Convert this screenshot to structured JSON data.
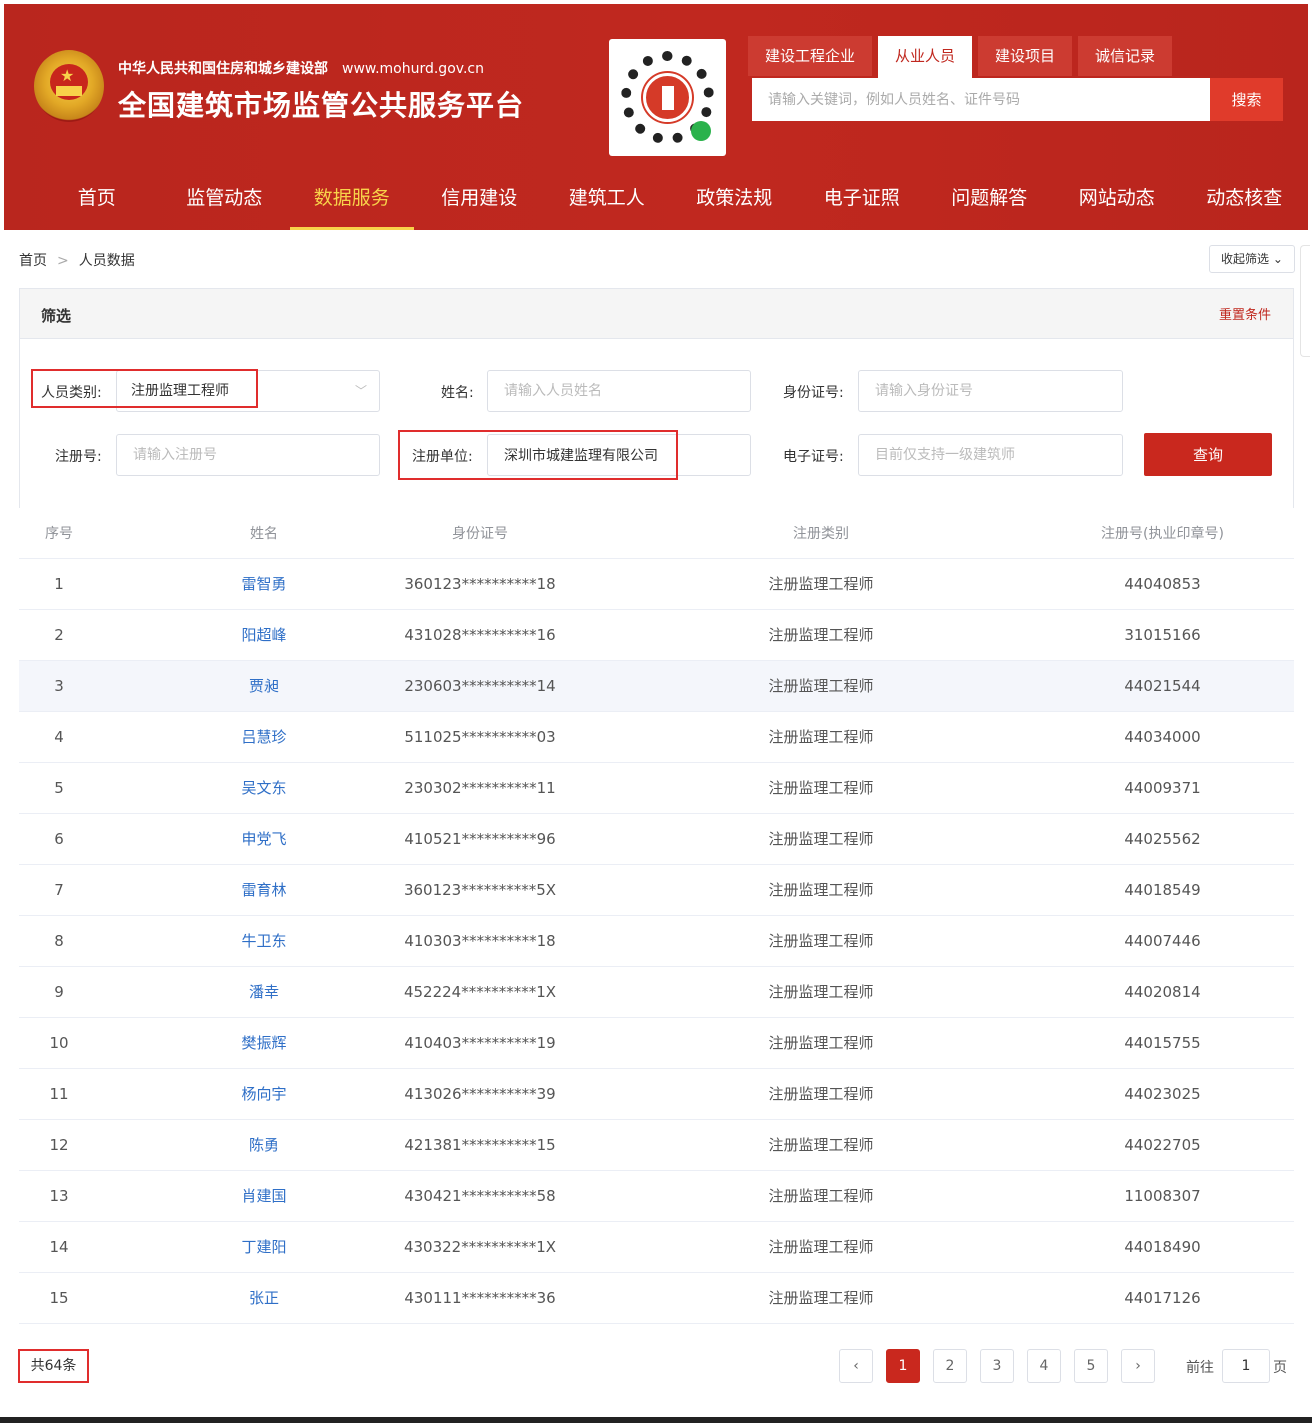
{
  "header": {
    "dept": "中华人民共和国住房和城乡建设部",
    "url": "www.mohurd.gov.cn",
    "title": "全国建筑市场监管公共服务平台"
  },
  "search": {
    "tabs": [
      {
        "label": "建设工程企业",
        "active": false
      },
      {
        "label": "从业人员",
        "active": true
      },
      {
        "label": "建设项目",
        "active": false
      },
      {
        "label": "诚信记录",
        "active": false
      }
    ],
    "placeholder": "请输入关键词，例如人员姓名、证件号码",
    "button": "搜索"
  },
  "nav": [
    {
      "label": "首页",
      "active": false
    },
    {
      "label": "监管动态",
      "active": false
    },
    {
      "label": "数据服务",
      "active": true
    },
    {
      "label": "信用建设",
      "active": false
    },
    {
      "label": "建筑工人",
      "active": false
    },
    {
      "label": "政策法规",
      "active": false
    },
    {
      "label": "电子证照",
      "active": false
    },
    {
      "label": "问题解答",
      "active": false
    },
    {
      "label": "网站动态",
      "active": false
    },
    {
      "label": "动态核查",
      "active": false
    }
  ],
  "breadcrumb": {
    "home": "首页",
    "current": "人员数据"
  },
  "collapse_filter": "收起筛选",
  "filter": {
    "title": "筛选",
    "reset": "重置条件",
    "person_type_label": "人员类别:",
    "person_type_value": "注册监理工程师",
    "name_label": "姓名:",
    "name_placeholder": "请输入人员姓名",
    "id_label": "身份证号:",
    "id_placeholder": "请输入身份证号",
    "reg_no_label": "注册号:",
    "reg_no_placeholder": "请输入注册号",
    "unit_label": "注册单位:",
    "unit_value": "深圳市城建监理有限公司",
    "cert_label": "电子证号:",
    "cert_placeholder": "目前仅支持一级建筑师",
    "query": "查询"
  },
  "table": {
    "headers": [
      "序号",
      "姓名",
      "身份证号",
      "注册类别",
      "注册号(执业印章号)"
    ],
    "rows": [
      [
        "1",
        "雷智勇",
        "360123**********18",
        "注册监理工程师",
        "44040853"
      ],
      [
        "2",
        "阳超峰",
        "431028**********16",
        "注册监理工程师",
        "31015166"
      ],
      [
        "3",
        "贾昶",
        "230603**********14",
        "注册监理工程师",
        "44021544"
      ],
      [
        "4",
        "吕慧珍",
        "511025**********03",
        "注册监理工程师",
        "44034000"
      ],
      [
        "5",
        "吴文东",
        "230302**********11",
        "注册监理工程师",
        "44009371"
      ],
      [
        "6",
        "申党飞",
        "410521**********96",
        "注册监理工程师",
        "44025562"
      ],
      [
        "7",
        "雷育林",
        "360123**********5X",
        "注册监理工程师",
        "44018549"
      ],
      [
        "8",
        "牛卫东",
        "410303**********18",
        "注册监理工程师",
        "44007446"
      ],
      [
        "9",
        "潘幸",
        "452224**********1X",
        "注册监理工程师",
        "44020814"
      ],
      [
        "10",
        "樊振辉",
        "410403**********19",
        "注册监理工程师",
        "44015755"
      ],
      [
        "11",
        "杨向宇",
        "413026**********39",
        "注册监理工程师",
        "44023025"
      ],
      [
        "12",
        "陈勇",
        "421381**********15",
        "注册监理工程师",
        "44022705"
      ],
      [
        "13",
        "肖建国",
        "430421**********58",
        "注册监理工程师",
        "11008307"
      ],
      [
        "14",
        "丁建阳",
        "430322**********1X",
        "注册监理工程师",
        "44018490"
      ],
      [
        "15",
        "张正",
        "430111**********36",
        "注册监理工程师",
        "44017126"
      ]
    ]
  },
  "pagination": {
    "total": "共64条",
    "prev": "‹",
    "next": "›",
    "pages": [
      "1",
      "2",
      "3",
      "4",
      "5"
    ],
    "current": "1",
    "goto_label": "前往",
    "goto_value": "1",
    "goto_unit": "页"
  },
  "colors": {
    "brand_red": "#c0281f",
    "nav_active": "#f8d24a",
    "link_blue": "#2f6fc7"
  }
}
